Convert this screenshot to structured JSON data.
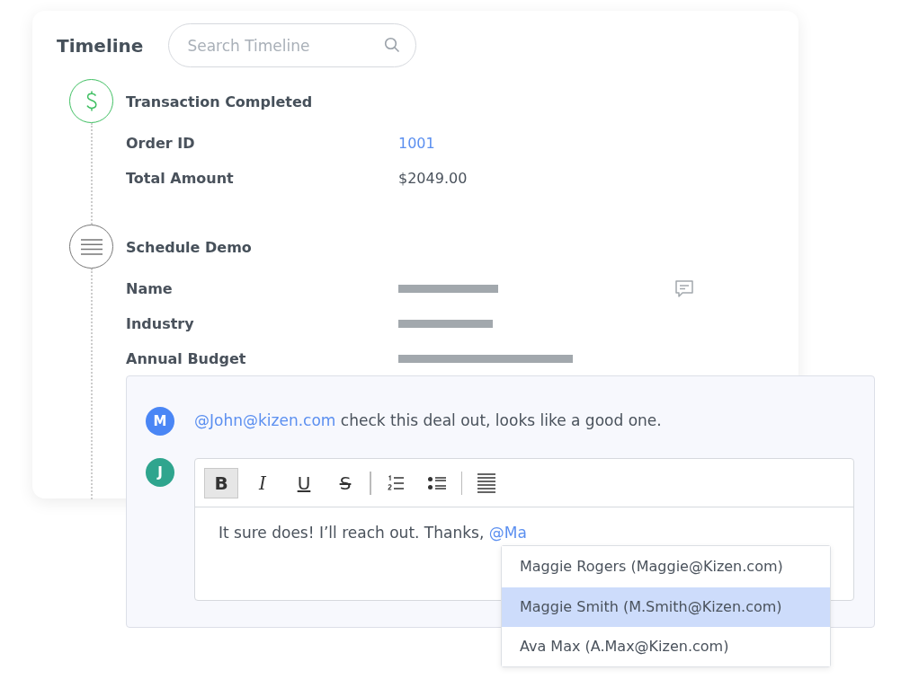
{
  "timeline": {
    "title": "Timeline",
    "search": {
      "placeholder": "Search Timeline"
    },
    "events": [
      {
        "kind": "transaction",
        "title": "Transaction Completed",
        "fields": [
          {
            "label": "Order ID",
            "value": "1001",
            "link": true,
            "redacted": false,
            "commented": false
          },
          {
            "label": "Total Amount",
            "value": "$2049.00",
            "link": false,
            "redacted": false,
            "commented": false
          }
        ]
      },
      {
        "kind": "form",
        "title": "Schedule Demo",
        "fields": [
          {
            "label": "Name",
            "redacted": true,
            "commented": true
          },
          {
            "label": "Industry",
            "redacted": true,
            "commented": false
          },
          {
            "label": "Annual Budget",
            "redacted": true,
            "commented": false
          }
        ]
      }
    ]
  },
  "comments": {
    "messages": [
      {
        "initial": "M",
        "color": "#4a86f5",
        "mention": "@John@kizen.com",
        "text": "check this deal out, looks like a good one."
      }
    ],
    "reply": {
      "initial": "J",
      "color": "#2fa58e",
      "toolbar": [
        {
          "kind": "bold",
          "label": "B",
          "active": true
        },
        {
          "kind": "italic",
          "label": "I",
          "active": false
        },
        {
          "kind": "underline",
          "label": "U",
          "active": false
        },
        {
          "kind": "strike",
          "label": "S",
          "active": false
        },
        {
          "kind": "divider"
        },
        {
          "kind": "ordered-list",
          "active": false
        },
        {
          "kind": "bullet-list",
          "active": false
        },
        {
          "kind": "divider"
        },
        {
          "kind": "justify",
          "active": false
        }
      ],
      "text": "It sure does! I’ll reach out. Thanks,",
      "mention": "@Ma",
      "suggestions": [
        {
          "label": "Maggie Rogers (Maggie@Kizen.com)",
          "selected": false
        },
        {
          "label": "Maggie Smith (M.Smith@Kizen.com)",
          "selected": true
        },
        {
          "label": "Ava Max (A.Max@Kizen.com)",
          "selected": false
        }
      ]
    }
  }
}
